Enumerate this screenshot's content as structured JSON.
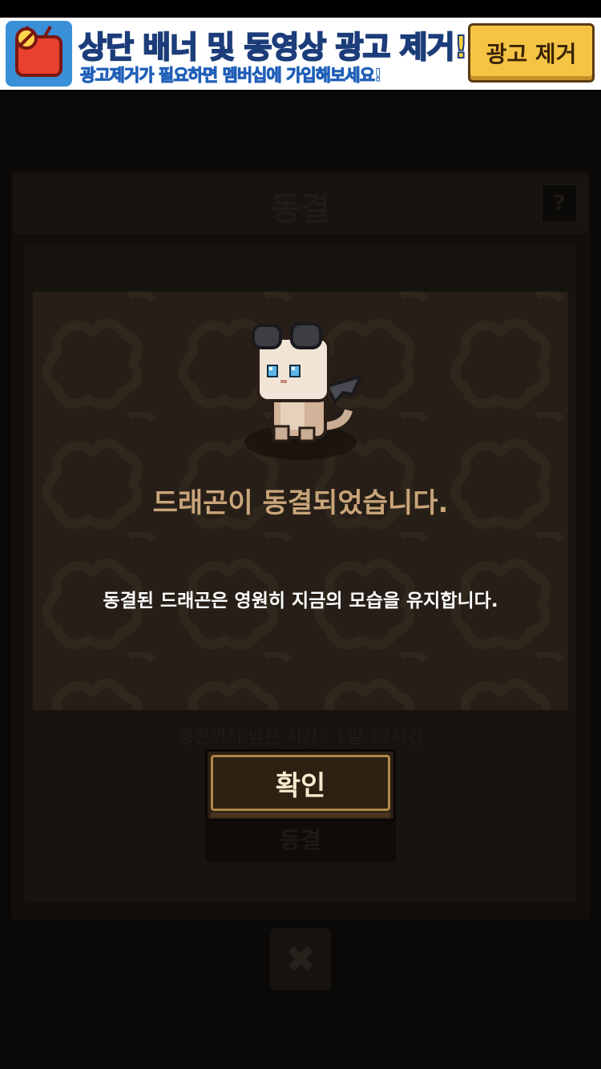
{
  "ad_banner": {
    "title": "상단 배너 및 동영상 광고 제거!",
    "subtitle": "광고제거가 필요하면 멤버십에 가입해보세요!",
    "remove_button_label": "광고 제거",
    "icon": "no-ad-tv-icon"
  },
  "background_screen": {
    "title": "동결",
    "help_label": "?",
    "timer_text": "충전까지 남은 시간 : 1일 17시간",
    "action_label": "동결",
    "close_label": "✖"
  },
  "popup": {
    "character_icon": "baby-dragon-sprite",
    "title": "드래곤이 동결되었습니다.",
    "description": "동결된 드래곤은 영원히 지금의 모습을 유지합니다.",
    "confirm_label": "확인"
  },
  "colors": {
    "popup_bg": "#271f17",
    "title_text": "#c9a57a",
    "button_border": "#b08746",
    "ad_title": "#ffd43a",
    "ad_button": "#f6c444"
  }
}
